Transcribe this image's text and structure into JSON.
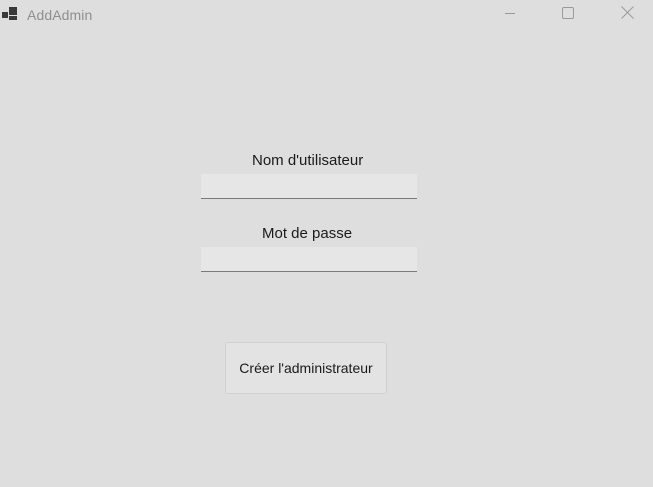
{
  "window": {
    "title": "AddAdmin",
    "icons": {
      "app": "app-icon",
      "minimize": "minimize-icon",
      "maximize": "maximize-icon",
      "close": "close-icon"
    }
  },
  "form": {
    "username_label": "Nom d'utilisateur",
    "username_value": "",
    "password_label": "Mot de passe",
    "password_value": "",
    "submit_label": "Créer l'administrateur"
  },
  "colors": {
    "background": "#dedede",
    "title_text": "#8f8f8f",
    "textbox_fill": "#e6e6e6",
    "textbox_underline": "#7a7a7a",
    "button_fill": "#e3e3e3"
  }
}
